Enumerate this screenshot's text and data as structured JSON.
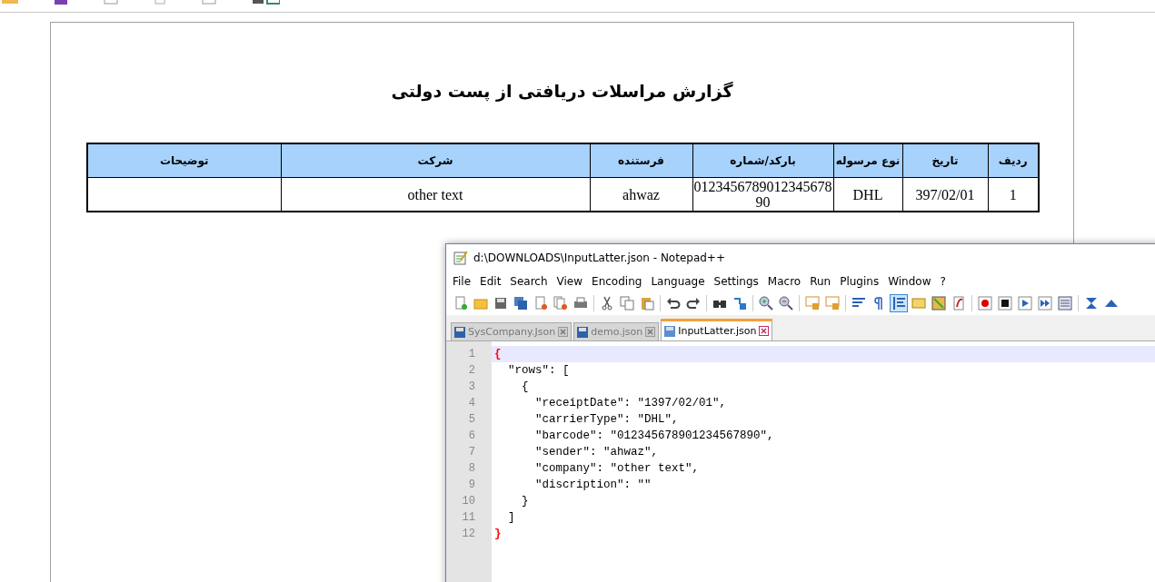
{
  "report": {
    "title": "گزارش مراسلات دریافتی از پست دولتی",
    "columns": [
      "توضیحات",
      "شرکت",
      "فرستنده",
      "بارکد/شماره",
      "نوع مرسوله",
      "تاریخ",
      "ردیف"
    ],
    "rows": [
      [
        "",
        "other text",
        "ahwaz",
        "012345678901234567890",
        "DHL",
        "397/02/01",
        "1"
      ]
    ]
  },
  "notepad": {
    "title": "d:\\DOWNLOADS\\InputLatter.json - Notepad++",
    "menu": [
      "File",
      "Edit",
      "Search",
      "View",
      "Encoding",
      "Language",
      "Settings",
      "Macro",
      "Run",
      "Plugins",
      "Window",
      "?"
    ],
    "toolbar_groups": [
      {
        "buttons": [
          {
            "kind": "new",
            "selected": false
          },
          {
            "kind": "open",
            "selected": false
          },
          {
            "kind": "save",
            "selected": false
          },
          {
            "kind": "save-all",
            "selected": false
          },
          {
            "kind": "close",
            "selected": false
          },
          {
            "kind": "close-all",
            "selected": false
          },
          {
            "kind": "print",
            "selected": false
          }
        ]
      },
      {
        "buttons": [
          {
            "kind": "cut",
            "selected": false
          },
          {
            "kind": "copy",
            "selected": false
          },
          {
            "kind": "paste",
            "selected": false
          }
        ]
      },
      {
        "buttons": [
          {
            "kind": "undo",
            "selected": false
          },
          {
            "kind": "redo",
            "selected": false
          }
        ]
      },
      {
        "buttons": [
          {
            "kind": "find",
            "selected": false
          },
          {
            "kind": "replace",
            "selected": false
          }
        ]
      },
      {
        "buttons": [
          {
            "kind": "zoom-in",
            "selected": false
          },
          {
            "kind": "zoom-out",
            "selected": false
          }
        ]
      },
      {
        "buttons": [
          {
            "kind": "sync-v",
            "selected": false
          },
          {
            "kind": "sync-h",
            "selected": false
          }
        ]
      },
      {
        "buttons": [
          {
            "kind": "wrap",
            "selected": false
          },
          {
            "kind": "all-chars",
            "selected": false
          },
          {
            "kind": "indent-guide",
            "selected": true
          },
          {
            "kind": "lang",
            "selected": false
          },
          {
            "kind": "map",
            "selected": false
          },
          {
            "kind": "func",
            "selected": false
          }
        ]
      },
      {
        "buttons": [
          {
            "kind": "record",
            "selected": false
          },
          {
            "kind": "stop",
            "selected": false
          },
          {
            "kind": "play",
            "selected": false
          },
          {
            "kind": "play-multi",
            "selected": false
          },
          {
            "kind": "save-macro",
            "selected": false
          }
        ]
      },
      {
        "buttons": [
          {
            "kind": "fold",
            "selected": false
          },
          {
            "kind": "up",
            "selected": false
          }
        ]
      }
    ],
    "tabs": [
      {
        "label": "SysCompany.Json",
        "selected": false
      },
      {
        "label": "demo.json",
        "selected": false
      },
      {
        "label": "InputLatter.json",
        "selected": true
      }
    ],
    "lines": [
      {
        "number": "1",
        "text": "{",
        "kind": "brace",
        "selected": true
      },
      {
        "number": "2",
        "text": "  \"rows\": [",
        "kind": "plain",
        "selected": false
      },
      {
        "number": "3",
        "text": "    {",
        "kind": "plain",
        "selected": false
      },
      {
        "number": "4",
        "text": "      \"receiptDate\": \"1397/02/01\",",
        "kind": "plain",
        "selected": false
      },
      {
        "number": "5",
        "text": "      \"carrierType\": \"DHL\",",
        "kind": "plain",
        "selected": false
      },
      {
        "number": "6",
        "text": "      \"barcode\": \"012345678901234567890\",",
        "kind": "plain",
        "selected": false
      },
      {
        "number": "7",
        "text": "      \"sender\": \"ahwaz\",",
        "kind": "plain",
        "selected": false
      },
      {
        "number": "8",
        "text": "      \"company\": \"other text\",",
        "kind": "plain",
        "selected": false
      },
      {
        "number": "9",
        "text": "      \"discription\": \"\"",
        "kind": "plain",
        "selected": false
      },
      {
        "number": "10",
        "text": "    }",
        "kind": "plain",
        "selected": false
      },
      {
        "number": "11",
        "text": "  ]",
        "kind": "plain",
        "selected": false
      },
      {
        "number": "12",
        "text": "}",
        "kind": "brace",
        "selected": false
      }
    ]
  }
}
